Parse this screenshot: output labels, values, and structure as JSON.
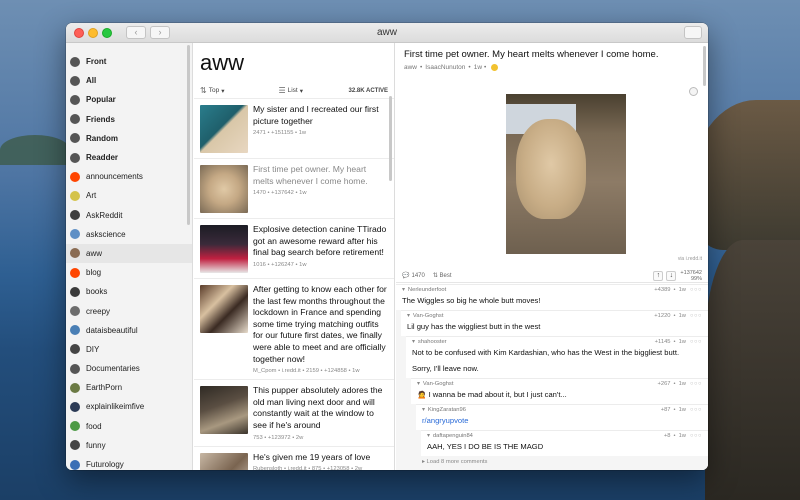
{
  "window": {
    "title": "aww"
  },
  "sidebar": {
    "items": [
      {
        "label": "Front",
        "bold": true,
        "color": "#555555"
      },
      {
        "label": "All",
        "bold": true,
        "color": "#555555"
      },
      {
        "label": "Popular",
        "bold": true,
        "color": "#555555"
      },
      {
        "label": "Friends",
        "bold": true,
        "color": "#555555"
      },
      {
        "label": "Random",
        "bold": true,
        "color": "#555555"
      },
      {
        "label": "Readder",
        "bold": true,
        "color": "#555555"
      },
      {
        "label": "announcements",
        "bold": false,
        "color": "#ff4500"
      },
      {
        "label": "Art",
        "bold": false,
        "color": "#d4c34a"
      },
      {
        "label": "AskReddit",
        "bold": false,
        "color": "#3e3e3e"
      },
      {
        "label": "askscience",
        "bold": false,
        "color": "#5e8fc5"
      },
      {
        "label": "aww",
        "bold": false,
        "color": "#8a6b52",
        "selected": true
      },
      {
        "label": "blog",
        "bold": false,
        "color": "#ff4500"
      },
      {
        "label": "books",
        "bold": false,
        "color": "#3b3b3b"
      },
      {
        "label": "creepy",
        "bold": false,
        "color": "#6d6d6d"
      },
      {
        "label": "dataisbeautiful",
        "bold": false,
        "color": "#4a7fb5"
      },
      {
        "label": "DIY",
        "bold": false,
        "color": "#444444"
      },
      {
        "label": "Documentaries",
        "bold": false,
        "color": "#555555"
      },
      {
        "label": "EarthPorn",
        "bold": false,
        "color": "#6b7a44"
      },
      {
        "label": "explainlikeimfive",
        "bold": false,
        "color": "#2b3a55"
      },
      {
        "label": "food",
        "bold": false,
        "color": "#4c9a45"
      },
      {
        "label": "funny",
        "bold": false,
        "color": "#444444"
      },
      {
        "label": "Futurology",
        "bold": false,
        "color": "#3b6fb5"
      }
    ]
  },
  "postlist": {
    "title": "aww",
    "sort_label": "Top",
    "view_label": "List",
    "active_label": "32.8K ACTIVE",
    "posts": [
      {
        "title": "My sister and I recreated our first picture together",
        "meta": "2471 • +151155 • 1w",
        "read": false,
        "thumb": "linear-gradient(135deg,#2a7d8c 0%,#1f5f6b 45%,#d9c7a8 50%,#e8d7c1 100%)"
      },
      {
        "title": "First time pet owner. My heart melts whenever I come home.",
        "meta": "1470 • +137642 • 1w",
        "read": true,
        "thumb": "radial-gradient(circle at 50% 50%,#e0c9a6 0%,#c4a884 45%,#7a6a55 100%)"
      },
      {
        "title": "Explosive detection canine TTirado got an awesome reward after his final bag search before retirement!",
        "meta": "1016 • +126247 • 1w",
        "read": false,
        "thumb": "linear-gradient(180deg,#1c1c24 0%,#3a2a3a 40%,#c02040 70%,#e8e8e8 100%)"
      },
      {
        "title": "After getting to know each other for the last few months throughout the lockdown in France and spending some time trying matching outfits for our future first dates, we finally were able to meet and are officially together now!",
        "meta": "M_Cpom • i.redd.it • 2159 • +124858 • 1w",
        "read": false,
        "thumb": "linear-gradient(135deg,#5a3c2a 0%,#d8c0a0 35%,#3a2a22 60%,#e8dccc 100%)"
      },
      {
        "title": "This pupper absolutely adores the old man living next door and will constantly wait at the window to see if he's around",
        "meta": "753 • +123972 • 2w",
        "read": false,
        "thumb": "linear-gradient(160deg,#2f2a24 0%,#5a4e42 40%,#a89880 70%,#3a332b 100%)"
      },
      {
        "title": "He's given me 19 years of love",
        "meta": "Rubensloth • i.redd.it • 875 • +123058 • 2w",
        "read": false,
        "thumb": "linear-gradient(135deg,#c7b7a4 0%,#7a6450 50%,#e3d8cc 100%)"
      }
    ]
  },
  "detail": {
    "title": "First time pet owner. My heart melts whenever I come home.",
    "subreddit": "aww",
    "author": "IsaacNunuton",
    "age": "1w",
    "source": "via i.redd.it",
    "comment_count": "1470",
    "sort_label": "Best",
    "score": "+137642",
    "score_sub": "99%",
    "comments": [
      {
        "depth": 0,
        "user": "Nerleunderfoot",
        "score": "+4389",
        "age": "1w",
        "text": "The Wiggles so big he whole butt moves!"
      },
      {
        "depth": 1,
        "user": "Van-Goghst",
        "score": "+1220",
        "age": "1w",
        "text": "Lil guy has the wiggliest butt in the west"
      },
      {
        "depth": 2,
        "user": "shahooster",
        "score": "+1145",
        "age": "1w",
        "text": "Not to be confused with Kim Kardashian, who has the West in the biggliest butt.",
        "text2": "Sorry, I'll leave now."
      },
      {
        "depth": 3,
        "user": "Van-Goghst",
        "score": "+267",
        "age": "1w",
        "text": "🙍 I wanna be mad about it, but I just can't..."
      },
      {
        "depth": 4,
        "user": "KingZaratan96",
        "score": "+87",
        "age": "1w",
        "text": "r/angryupvote",
        "link": true
      },
      {
        "depth": 5,
        "user": "daftapenguin84",
        "score": "+8",
        "age": "1w",
        "text": "AAH, YES I DO BE IS THE MAGD"
      }
    ],
    "load_more": "Load 8 more comments"
  }
}
